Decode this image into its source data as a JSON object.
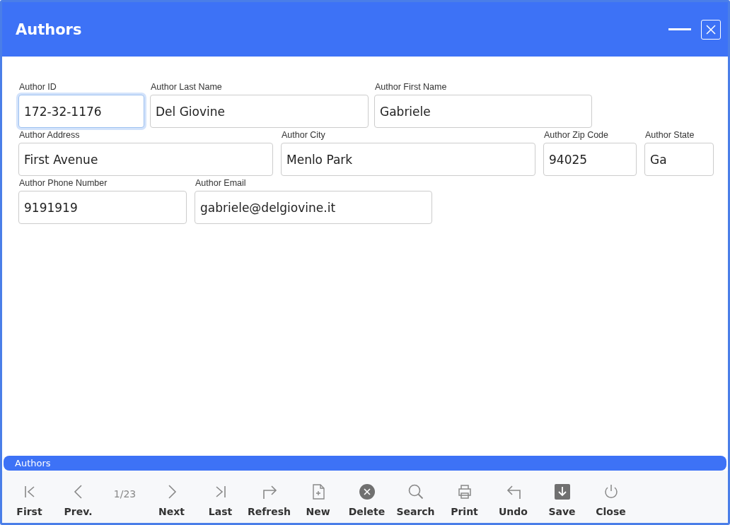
{
  "window": {
    "title": "Authors"
  },
  "form": {
    "rows": [
      [
        {
          "label": "Author ID",
          "value": "172-32-1176",
          "focused": true
        },
        {
          "label": "Author Last Name",
          "value": "Del Giovine",
          "focused": false
        },
        {
          "label": "Author First Name",
          "value": "Gabriele",
          "focused": false
        }
      ],
      [
        {
          "label": "Author Address",
          "value": "First Avenue",
          "focused": false
        },
        {
          "label": "Author City",
          "value": "Menlo Park",
          "focused": false
        },
        {
          "label": "Author Zip Code",
          "value": "94025",
          "focused": false
        },
        {
          "label": "Author State",
          "value": "Ga",
          "focused": false
        }
      ],
      [
        {
          "label": "Author Phone Number",
          "value": "9191919",
          "focused": false
        },
        {
          "label": "Author Email",
          "value": "gabriele@delgiovine.it",
          "focused": false
        }
      ]
    ]
  },
  "status_bar": {
    "title": "Authors"
  },
  "toolbar": [
    {
      "kind": "button",
      "label": "First"
    },
    {
      "kind": "button",
      "label": "Prev."
    },
    {
      "kind": "counter",
      "label": "1/23"
    },
    {
      "kind": "button",
      "label": "Next"
    },
    {
      "kind": "button",
      "label": "Last"
    },
    {
      "kind": "button",
      "label": "Refresh"
    },
    {
      "kind": "button",
      "label": "New"
    },
    {
      "kind": "button",
      "label": "Delete"
    },
    {
      "kind": "button",
      "label": "Search"
    },
    {
      "kind": "button",
      "label": "Print"
    },
    {
      "kind": "button",
      "label": "Undo"
    },
    {
      "kind": "button",
      "label": "Save"
    },
    {
      "kind": "button",
      "label": "Close"
    }
  ]
}
